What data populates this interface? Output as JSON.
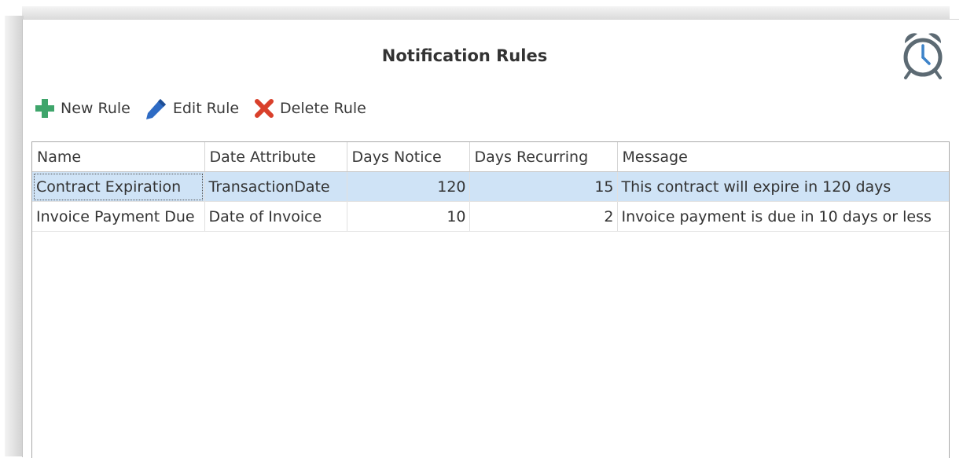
{
  "panel": {
    "title": "Notification Rules",
    "icon": "alarm-clock-icon"
  },
  "toolbar": {
    "new_label": "New Rule",
    "new_icon": "plus-icon",
    "edit_label": "Edit Rule",
    "edit_icon": "pencil-icon",
    "delete_label": "Delete Rule",
    "delete_icon": "x-icon"
  },
  "colors": {
    "plus": "#3fa56b",
    "pencil": "#2e6bc4",
    "delete": "#d9402b",
    "selection": "#cfe3f6"
  },
  "grid": {
    "columns": [
      "Name",
      "Date Attribute",
      "Days Notice",
      "Days Recurring",
      "Message"
    ],
    "rows": [
      {
        "name": "Contract Expiration",
        "date_attribute": "TransactionDate",
        "days_notice": "120",
        "days_recurring": "15",
        "message": "This contract will expire in 120 days",
        "selected": true
      },
      {
        "name": "Invoice Payment Due",
        "date_attribute": "Date of Invoice",
        "days_notice": "10",
        "days_recurring": "2",
        "message": "Invoice payment is due in 10 days or less",
        "selected": false
      }
    ]
  }
}
